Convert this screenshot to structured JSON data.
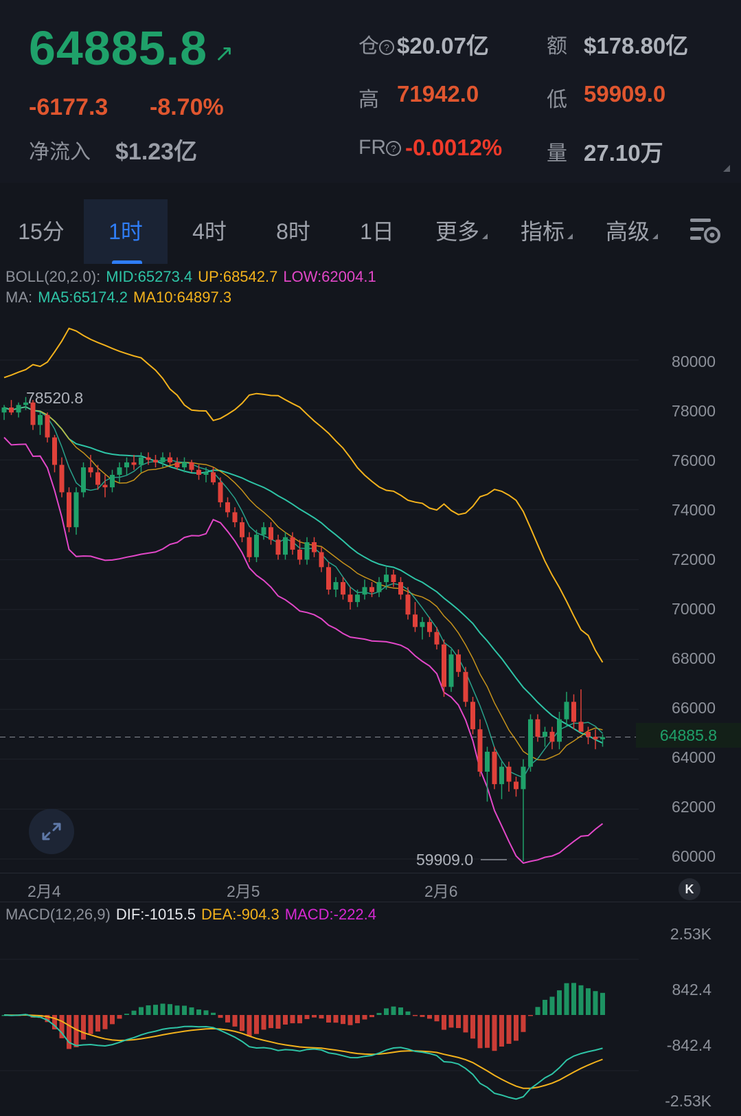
{
  "header": {
    "price": "64885.8",
    "price_arrow": "↗",
    "change": "-6177.3",
    "change_pct": "-8.70%",
    "inflow_label": "净流入",
    "inflow_value": "$1.23亿",
    "open_interest_label": "仓",
    "open_interest_value": "$20.07亿",
    "turnover_label": "额",
    "turnover_value": "$178.80亿",
    "high_label": "高",
    "high_value": "71942.0",
    "low_label": "低",
    "low_value": "59909.0",
    "fr_label": "FR",
    "fr_value": "-0.0012%",
    "volume_label": "量",
    "volume_value": "27.10万",
    "help_icon": "?"
  },
  "tabs": [
    {
      "label": "15分"
    },
    {
      "label": "1时"
    },
    {
      "label": "4时"
    },
    {
      "label": "8时"
    },
    {
      "label": "1日"
    },
    {
      "label": "更多"
    },
    {
      "label": "指标"
    },
    {
      "label": "高级"
    }
  ],
  "settings_icon": "chart-settings-icon",
  "boll_legend": {
    "name": "BOLL(20,2.0):",
    "mid": "MID:65273.4",
    "up": "UP:68542.7",
    "low": "LOW:62004.1"
  },
  "ma_legend": {
    "name": "MA:",
    "ma5": "MA5:65174.2",
    "ma10": "MA10:64897.3"
  },
  "price_axis": [
    "80000",
    "78000",
    "76000",
    "74000",
    "72000",
    "70000",
    "68000",
    "66000",
    "64000",
    "62000",
    "60000"
  ],
  "current_price_tag": "64885.8",
  "annotations": {
    "high_mark": "78520.8",
    "low_mark": "59909.0"
  },
  "dates": [
    "2月4",
    "2月5",
    "2月6"
  ],
  "back_icon": "K",
  "macd_legend": {
    "name": "MACD(12,26,9)",
    "dif": "DIF:-1015.5",
    "dea": "DEA:-904.3",
    "macd": "MACD:-222.4"
  },
  "macd_axis": [
    "2.53K",
    "842.4",
    "-842.4",
    "-2.53K"
  ],
  "colors": {
    "up": "#1fa16a",
    "down": "#e0413a",
    "boll_mid": "#2ec4a6",
    "boll_up": "#f3b21c",
    "boll_low": "#e247c8",
    "accent": "#2f7df6"
  },
  "chart_data": {
    "type": "candlestick",
    "interval": "1时",
    "ylim": [
      59000,
      81500
    ],
    "candles": [
      {
        "o": 77900,
        "h": 78200,
        "l": 77600,
        "c": 78100
      },
      {
        "o": 78100,
        "h": 78400,
        "l": 77800,
        "c": 77900
      },
      {
        "o": 77900,
        "h": 78300,
        "l": 77700,
        "c": 78200
      },
      {
        "o": 78200,
        "h": 78520.8,
        "l": 78000,
        "c": 78300
      },
      {
        "o": 78300,
        "h": 78400,
        "l": 77200,
        "c": 77400
      },
      {
        "o": 77400,
        "h": 77900,
        "l": 77000,
        "c": 77800
      },
      {
        "o": 77800,
        "h": 77900,
        "l": 76700,
        "c": 76900
      },
      {
        "o": 76900,
        "h": 77000,
        "l": 75500,
        "c": 75800
      },
      {
        "o": 75800,
        "h": 76100,
        "l": 74500,
        "c": 74700
      },
      {
        "o": 74700,
        "h": 74900,
        "l": 73100,
        "c": 73300
      },
      {
        "o": 73300,
        "h": 74900,
        "l": 73000,
        "c": 74700
      },
      {
        "o": 74700,
        "h": 75900,
        "l": 74500,
        "c": 75700
      },
      {
        "o": 75700,
        "h": 76200,
        "l": 75300,
        "c": 75500
      },
      {
        "o": 75500,
        "h": 75800,
        "l": 74800,
        "c": 75000
      },
      {
        "o": 75000,
        "h": 75400,
        "l": 74500,
        "c": 74900
      },
      {
        "o": 74900,
        "h": 75600,
        "l": 74700,
        "c": 75400
      },
      {
        "o": 75400,
        "h": 75900,
        "l": 75100,
        "c": 75700
      },
      {
        "o": 75700,
        "h": 76100,
        "l": 75400,
        "c": 75900
      },
      {
        "o": 75900,
        "h": 76200,
        "l": 75600,
        "c": 75800
      },
      {
        "o": 75800,
        "h": 76300,
        "l": 75500,
        "c": 76100
      },
      {
        "o": 76100,
        "h": 76300,
        "l": 75800,
        "c": 76000
      },
      {
        "o": 76000,
        "h": 76200,
        "l": 75700,
        "c": 75900
      },
      {
        "o": 75900,
        "h": 76300,
        "l": 75700,
        "c": 76100
      },
      {
        "o": 76100,
        "h": 76300,
        "l": 75800,
        "c": 75900
      },
      {
        "o": 75900,
        "h": 76100,
        "l": 75600,
        "c": 75700
      },
      {
        "o": 75700,
        "h": 76100,
        "l": 75500,
        "c": 75900
      },
      {
        "o": 75900,
        "h": 76000,
        "l": 75500,
        "c": 75600
      },
      {
        "o": 75600,
        "h": 75800,
        "l": 75200,
        "c": 75400
      },
      {
        "o": 75400,
        "h": 75700,
        "l": 75100,
        "c": 75500
      },
      {
        "o": 75500,
        "h": 75700,
        "l": 75000,
        "c": 75100
      },
      {
        "o": 75100,
        "h": 75300,
        "l": 74100,
        "c": 74300
      },
      {
        "o": 74300,
        "h": 74500,
        "l": 73700,
        "c": 73900
      },
      {
        "o": 73900,
        "h": 74100,
        "l": 73300,
        "c": 73500
      },
      {
        "o": 73500,
        "h": 73700,
        "l": 72700,
        "c": 72900
      },
      {
        "o": 72900,
        "h": 73100,
        "l": 71900,
        "c": 72100
      },
      {
        "o": 72100,
        "h": 73200,
        "l": 71900,
        "c": 73000
      },
      {
        "o": 73000,
        "h": 73500,
        "l": 72800,
        "c": 73300
      },
      {
        "o": 73300,
        "h": 73500,
        "l": 72600,
        "c": 72800
      },
      {
        "o": 72800,
        "h": 73000,
        "l": 72000,
        "c": 72200
      },
      {
        "o": 72200,
        "h": 73100,
        "l": 72000,
        "c": 72900
      },
      {
        "o": 72900,
        "h": 73100,
        "l": 72200,
        "c": 72400
      },
      {
        "o": 72400,
        "h": 72800,
        "l": 71800,
        "c": 72000
      },
      {
        "o": 72000,
        "h": 72900,
        "l": 71800,
        "c": 72700
      },
      {
        "o": 72700,
        "h": 72900,
        "l": 72100,
        "c": 72300
      },
      {
        "o": 72300,
        "h": 72500,
        "l": 71500,
        "c": 71700
      },
      {
        "o": 71700,
        "h": 71900,
        "l": 70600,
        "c": 70800
      },
      {
        "o": 70800,
        "h": 71300,
        "l": 70500,
        "c": 71100
      },
      {
        "o": 71100,
        "h": 71300,
        "l": 70400,
        "c": 70600
      },
      {
        "o": 70600,
        "h": 70900,
        "l": 70000,
        "c": 70300
      },
      {
        "o": 70300,
        "h": 70800,
        "l": 70100,
        "c": 70600
      },
      {
        "o": 70600,
        "h": 71200,
        "l": 70400,
        "c": 70900
      },
      {
        "o": 70900,
        "h": 71100,
        "l": 70500,
        "c": 70700
      },
      {
        "o": 70700,
        "h": 71300,
        "l": 70500,
        "c": 71100
      },
      {
        "o": 71100,
        "h": 71700,
        "l": 70800,
        "c": 71400
      },
      {
        "o": 71400,
        "h": 71600,
        "l": 70900,
        "c": 71100
      },
      {
        "o": 71100,
        "h": 71300,
        "l": 70400,
        "c": 70600
      },
      {
        "o": 70600,
        "h": 70900,
        "l": 69600,
        "c": 69800
      },
      {
        "o": 69800,
        "h": 70300,
        "l": 69100,
        "c": 69300
      },
      {
        "o": 69300,
        "h": 69700,
        "l": 68800,
        "c": 69500
      },
      {
        "o": 69500,
        "h": 69700,
        "l": 68900,
        "c": 69100
      },
      {
        "o": 69100,
        "h": 69300,
        "l": 68400,
        "c": 68600
      },
      {
        "o": 68600,
        "h": 68800,
        "l": 66500,
        "c": 66900
      },
      {
        "o": 66900,
        "h": 68400,
        "l": 66700,
        "c": 68200
      },
      {
        "o": 68200,
        "h": 68400,
        "l": 67300,
        "c": 67500
      },
      {
        "o": 67500,
        "h": 67700,
        "l": 66100,
        "c": 66300
      },
      {
        "o": 66300,
        "h": 66500,
        "l": 65000,
        "c": 65200
      },
      {
        "o": 65200,
        "h": 65600,
        "l": 63300,
        "c": 63500
      },
      {
        "o": 63500,
        "h": 64500,
        "l": 62300,
        "c": 64300
      },
      {
        "o": 64300,
        "h": 64500,
        "l": 62800,
        "c": 63000
      },
      {
        "o": 63000,
        "h": 63900,
        "l": 62400,
        "c": 63700
      },
      {
        "o": 63700,
        "h": 63900,
        "l": 62700,
        "c": 63100
      },
      {
        "o": 63100,
        "h": 63300,
        "l": 62500,
        "c": 62800
      },
      {
        "o": 62800,
        "h": 64000,
        "l": 59909,
        "c": 63700
      },
      {
        "o": 63700,
        "h": 65800,
        "l": 63500,
        "c": 65600
      },
      {
        "o": 65600,
        "h": 65800,
        "l": 64700,
        "c": 64900
      },
      {
        "o": 64900,
        "h": 65300,
        "l": 64500,
        "c": 65100
      },
      {
        "o": 65100,
        "h": 65300,
        "l": 64400,
        "c": 64700
      },
      {
        "o": 64700,
        "h": 65900,
        "l": 64400,
        "c": 65600
      },
      {
        "o": 65600,
        "h": 66700,
        "l": 65300,
        "c": 66300
      },
      {
        "o": 66300,
        "h": 66600,
        "l": 65200,
        "c": 65500
      },
      {
        "o": 65500,
        "h": 66800,
        "l": 65100,
        "c": 65100
      },
      {
        "o": 65100,
        "h": 65300,
        "l": 64600,
        "c": 64900
      },
      {
        "o": 64900,
        "h": 65200,
        "l": 64400,
        "c": 64800
      },
      {
        "o": 64800,
        "h": 65000,
        "l": 64500,
        "c": 64885.8
      }
    ],
    "macd_ylim": [
      -2530,
      2530
    ]
  }
}
